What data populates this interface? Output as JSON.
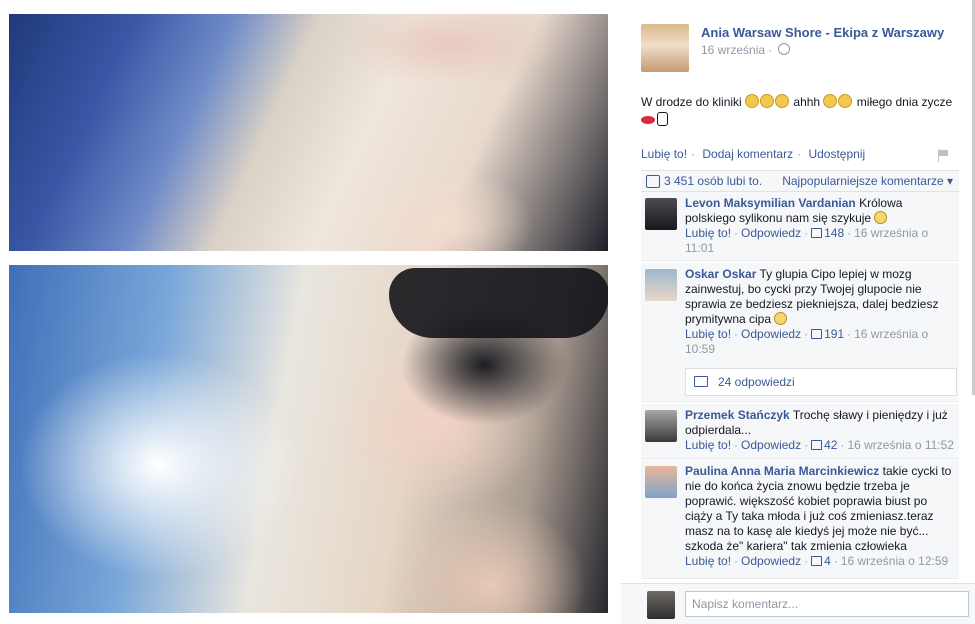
{
  "close_label": "×",
  "photos": [
    {
      "name": "selfie-top"
    },
    {
      "name": "selfie-bottom"
    }
  ],
  "post": {
    "page_name": "Ania Warsaw Shore - Ekipa z Warszawy",
    "date": "16 września",
    "text_1": "W drodze do kliniki",
    "text_2": "ahhh",
    "text_3": "miłego dnia",
    "text_4": "zycze",
    "actions": {
      "like": "Lubię to!",
      "comment": "Dodaj komentarz",
      "share": "Udostępnij"
    },
    "likes_text": "3 451 osób lubi to.",
    "sort_label": "Najpopularniejsze komentarze ▾"
  },
  "comments": [
    {
      "author": "Levon Maksymilian Vardanian",
      "text": "Królowa polskiego sylikonu nam się szykuje",
      "like": "Lubię to!",
      "reply": "Odpowiedz",
      "likes": "148",
      "time": "16 września o 11:01"
    },
    {
      "author": "Oskar Oskar",
      "text": "Ty glupia Cipo lepiej w mozg zainwestuj, bo cycki przy Twojej glupocie nie sprawia ze bedziesz piekniejsza, dalej bedziesz prymitywna cipa",
      "like": "Lubię to!",
      "reply": "Odpowiedz",
      "likes": "191",
      "time": "16 września o 10:59",
      "replies_label": "24 odpowiedzi"
    },
    {
      "author": "Przemek Stańczyk",
      "text": "Trochę sławy i pieniędzy i już odpierdala...",
      "like": "Lubię to!",
      "reply": "Odpowiedz",
      "likes": "42",
      "time": "16 września o 11:52"
    },
    {
      "author": "Paulina Anna Maria Marcinkiewicz",
      "text": "takie cycki to nie do końca życia znowu będzie trzeba je poprawić. większość kobiet poprawia biust po ciąży a Ty taka młoda i już coś zmieniasz.teraz masz na to kasę ale kiedyś jej może nie być... szkoda że\" kariera\" tak zmienia człowieka",
      "like": "Lubię to!",
      "reply": "Odpowiedz",
      "likes": "4",
      "time": "16 września o 12:59"
    }
  ],
  "compose": {
    "placeholder": "Napisz komentarz..."
  }
}
